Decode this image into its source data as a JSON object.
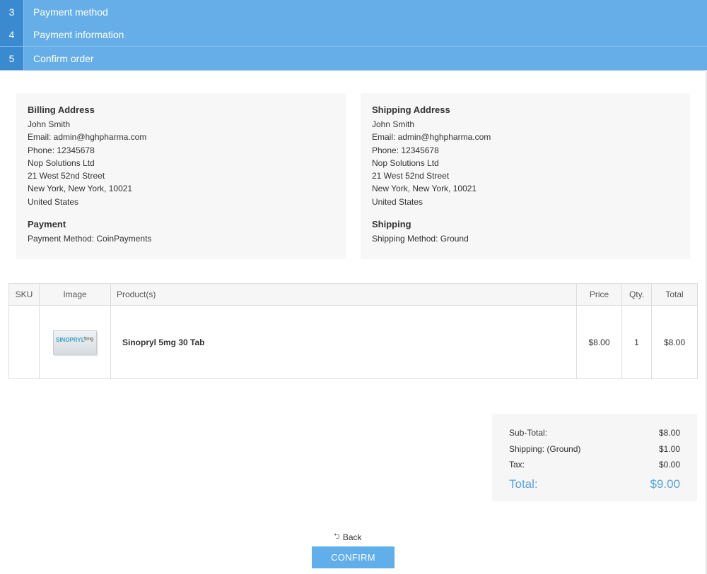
{
  "steps": [
    {
      "num": "3",
      "label": "Payment method"
    },
    {
      "num": "4",
      "label": "Payment information"
    },
    {
      "num": "5",
      "label": "Confirm order"
    }
  ],
  "billing": {
    "title": "Billing Address",
    "name": "John Smith",
    "email": "Email: admin@hghpharma.com",
    "phone": "Phone: 12345678",
    "company": "Nop Solutions Ltd",
    "street": "21 West 52nd Street",
    "city": "New York, New York, 10021",
    "country": "United States",
    "payment_title": "Payment",
    "payment_method": "Payment Method: CoinPayments"
  },
  "shipping": {
    "title": "Shipping Address",
    "name": "John Smith",
    "email": "Email: admin@hghpharma.com",
    "phone": "Phone: 12345678",
    "company": "Nop Solutions Ltd",
    "street": "21 West 52nd Street",
    "city": "New York, New York, 10021",
    "country": "United States",
    "shipping_title": "Shipping",
    "shipping_method": "Shipping Method: Ground"
  },
  "cart": {
    "headers": {
      "sku": "SKU",
      "image": "Image",
      "product": "Product(s)",
      "price": "Price",
      "qty": "Qty.",
      "total": "Total"
    },
    "items": [
      {
        "sku": "",
        "image_brand": "SINOPRYL",
        "image_dose": "5mg",
        "product": "Sinopryl 5mg 30 Tab",
        "price": "$8.00",
        "qty": "1",
        "total": "$8.00"
      }
    ]
  },
  "totals": {
    "subtotal_label": "Sub-Total:",
    "subtotal": "$8.00",
    "shipping_label": "Shipping: (Ground)",
    "shipping": "$1.00",
    "tax_label": "Tax:",
    "tax": "$0.00",
    "total_label": "Total:",
    "total": "$9.00"
  },
  "actions": {
    "back_label": "Back",
    "confirm_label": "CONFIRM"
  },
  "colors": {
    "step_bar": "#66aee8",
    "step_num": "#3a8ad0",
    "accent": "#57a3e0"
  }
}
